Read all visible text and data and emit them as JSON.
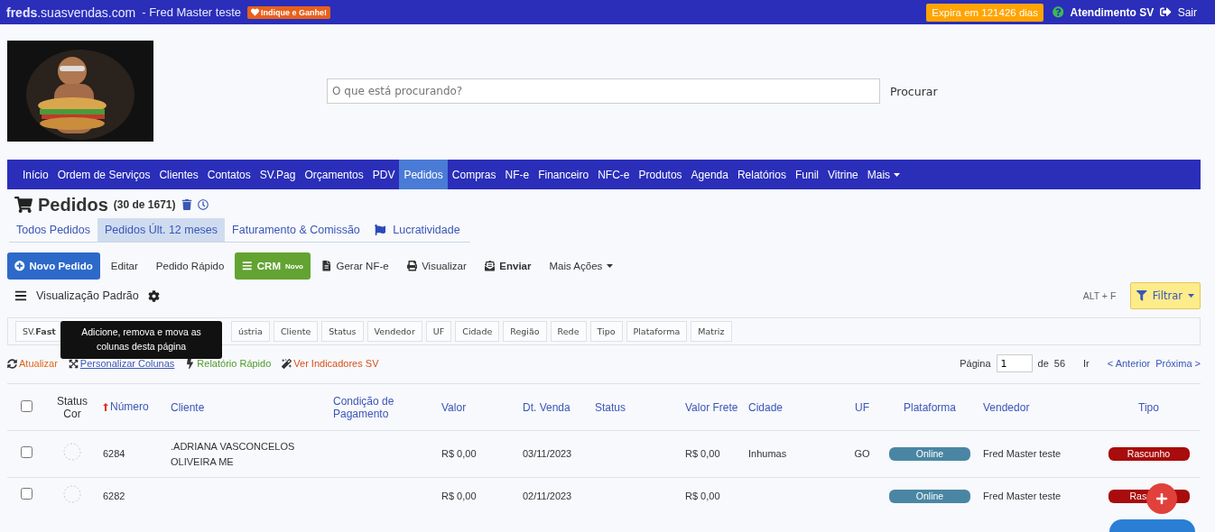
{
  "topbar": {
    "site_bold": "freds",
    "site_rest": ".suasvendas.com",
    "user": "- Fred Master teste",
    "referral": "Indique e Ganhe!",
    "expiry": "Expira em 121426 dias",
    "support": "Atendimento SV",
    "logout": "Sair"
  },
  "header": {
    "search": {
      "placeholder": "O que está procurando?",
      "button": "Procurar"
    }
  },
  "nav": [
    {
      "label": "Início",
      "selected": false
    },
    {
      "label": "Ordem de Serviços",
      "selected": false
    },
    {
      "label": "Clientes",
      "selected": false
    },
    {
      "label": "Contatos",
      "selected": false
    },
    {
      "label": "SV.Pag",
      "selected": false
    },
    {
      "label": "Orçamentos",
      "selected": false
    },
    {
      "label": "PDV",
      "selected": false
    },
    {
      "label": "Pedidos",
      "selected": true
    },
    {
      "label": "Compras",
      "selected": false
    },
    {
      "label": "NF-e",
      "selected": false
    },
    {
      "label": "Financeiro",
      "selected": false
    },
    {
      "label": "NFC-e",
      "selected": false
    },
    {
      "label": "Produtos",
      "selected": false
    },
    {
      "label": "Agenda",
      "selected": false
    },
    {
      "label": "Relatórios",
      "selected": false
    },
    {
      "label": "Funil",
      "selected": false
    },
    {
      "label": "Vitrine",
      "selected": false
    },
    {
      "label": "Mais",
      "selected": false,
      "kind": "dropdown"
    }
  ],
  "page": {
    "title": "Pedidos",
    "count": "(30 de 1671)"
  },
  "tabs": [
    {
      "label": "Todos Pedidos",
      "selected": false
    },
    {
      "label": "Pedidos Últ. 12 meses",
      "selected": true
    },
    {
      "label": "Faturamento & Comissão",
      "selected": false
    },
    {
      "label": "Lucratividade",
      "selected": false,
      "kind": "flag"
    }
  ],
  "actions": [
    {
      "label": "Novo Pedido",
      "kind": "primary"
    },
    {
      "label": "Editar",
      "kind": "plain"
    },
    {
      "label": "Pedido Rápido",
      "kind": "plain"
    },
    {
      "label": "CRM",
      "badge": "Novo",
      "kind": "crm"
    },
    {
      "label": "Gerar NF-e",
      "kind": "file"
    },
    {
      "label": "Visualizar",
      "kind": "print"
    },
    {
      "label": "Enviar",
      "kind": "send"
    },
    {
      "label": "Mais Ações",
      "kind": "dropdown"
    }
  ],
  "view": {
    "label": "Visualização Padrão",
    "shortcut": "ALT + F",
    "filter": "Filtrar"
  },
  "chips": [
    "SV.**Fast**",
    "ústria",
    "Cliente",
    "Status",
    "Vendedor",
    "UF",
    "Cidade",
    "Região",
    "Rede",
    "Tipo",
    "Plataforma",
    "Matriz"
  ],
  "tooltip": "Adicione, remova e mova as colunas desta página",
  "links": [
    {
      "label": "Atualizar",
      "kind": "refresh"
    },
    {
      "label": "Personalizar Colunas",
      "kind": "columns"
    },
    {
      "label": "Relatório Rápido",
      "kind": "bolt"
    },
    {
      "label": "Ver Indicadores SV",
      "kind": "wand"
    }
  ],
  "pager": {
    "label": "Página",
    "value": "1",
    "of": "de",
    "total": "56",
    "go": "Ir",
    "prev": "< Anterior",
    "next": "Próxima >"
  },
  "table": {
    "all_checked": false,
    "columns": [
      {
        "label": "Status Cor"
      },
      {
        "label": "Número",
        "sorted": true
      },
      {
        "label": "Cliente"
      },
      {
        "label": "Condição de Pagamento"
      },
      {
        "label": "Valor"
      },
      {
        "label": "Dt. Venda"
      },
      {
        "label": "Status"
      },
      {
        "label": "Valor Frete"
      },
      {
        "label": "Cidade"
      },
      {
        "label": "UF"
      },
      {
        "label": "Plataforma"
      },
      {
        "label": "Vendedor"
      },
      {
        "label": "Tipo"
      }
    ],
    "rows": [
      {
        "checked": false,
        "cells": [
          "",
          "6284",
          ".ADRIANA VASCONCELOS OLIVEIRA ME",
          "",
          "R$ 0,00",
          "03/11/2023",
          "",
          "R$ 0,00",
          "Inhumas",
          "GO",
          "Online",
          "Fred Master teste",
          "Rascunho"
        ]
      },
      {
        "checked": false,
        "cells": [
          "",
          "6282",
          "",
          "",
          "R$ 0,00",
          "02/11/2023",
          "",
          "R$ 0,00",
          "",
          "",
          "Online",
          "Fred Master teste",
          "Ras"
        ]
      }
    ]
  }
}
